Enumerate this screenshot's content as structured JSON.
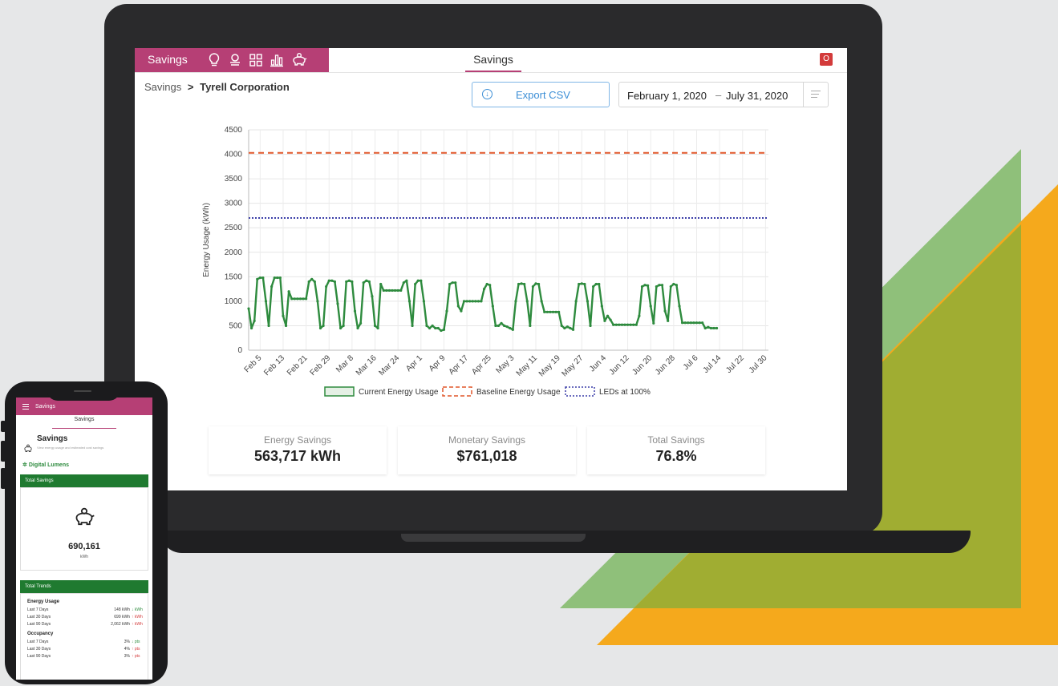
{
  "app": {
    "brand_label": "Savings",
    "center_tab": "Savings",
    "power_label": "O"
  },
  "nav_icons": [
    "lightbulb-icon",
    "occupancy-icon",
    "grid-icon",
    "bar-chart-icon",
    "piggy-bank-icon"
  ],
  "breadcrumb": {
    "root": "Savings",
    "separator": ">",
    "current": "Tyrell Corporation"
  },
  "toolbar": {
    "export_label": "Export CSV"
  },
  "date_range": {
    "start": "February 1, 2020",
    "separator": "–",
    "end": "July 31, 2020"
  },
  "colors": {
    "brand": "#b63f75",
    "current": "#2e8b3e",
    "baseline": "#e0572a",
    "leds": "#3b3fa8",
    "accent_green": "#1f7a30"
  },
  "chart_data": {
    "type": "line",
    "ylabel": "Energy Usage (kWh)",
    "ylim": [
      0,
      4500
    ],
    "yticks": [
      "0",
      "500",
      "1000",
      "1500",
      "2000",
      "2500",
      "3000",
      "3500",
      "4000",
      "4500"
    ],
    "xtick_labels": [
      "Feb 5",
      "Feb 13",
      "Feb 21",
      "Feb 29",
      "Mar 8",
      "Mar 16",
      "Mar 24",
      "Apr 1",
      "Apr 9",
      "Apr 17",
      "Apr 25",
      "May 3",
      "May 11",
      "May 19",
      "May 27",
      "Jun 4",
      "Jun 12",
      "Jun 20",
      "Jun 28",
      "Jul 6",
      "Jul 14",
      "Jul 22",
      "Jul 30"
    ],
    "grid": true,
    "legend_position": "bottom",
    "x_start": "2020-02-01",
    "x_end": "2020-07-31",
    "series": [
      {
        "name": "Current Energy Usage",
        "style": "solid",
        "color": "#2e8b3e",
        "points": [
          [
            "2020-02-01",
            850
          ],
          [
            "2020-02-02",
            450
          ],
          [
            "2020-02-03",
            600
          ],
          [
            "2020-02-04",
            1450
          ],
          [
            "2020-02-05",
            1480
          ],
          [
            "2020-02-06",
            1480
          ],
          [
            "2020-02-07",
            1000
          ],
          [
            "2020-02-08",
            500
          ],
          [
            "2020-02-09",
            1300
          ],
          [
            "2020-02-10",
            1480
          ],
          [
            "2020-02-11",
            1480
          ],
          [
            "2020-02-12",
            1480
          ],
          [
            "2020-02-13",
            700
          ],
          [
            "2020-02-14",
            500
          ],
          [
            "2020-02-15",
            1200
          ],
          [
            "2020-02-16",
            1050
          ],
          [
            "2020-02-17",
            1050
          ],
          [
            "2020-02-18",
            1050
          ],
          [
            "2020-02-19",
            1050
          ],
          [
            "2020-02-20",
            1050
          ],
          [
            "2020-02-21",
            1050
          ],
          [
            "2020-02-22",
            1400
          ],
          [
            "2020-02-23",
            1450
          ],
          [
            "2020-02-24",
            1400
          ],
          [
            "2020-02-25",
            1000
          ],
          [
            "2020-02-26",
            450
          ],
          [
            "2020-02-27",
            500
          ],
          [
            "2020-02-28",
            1300
          ],
          [
            "2020-02-29",
            1420
          ],
          [
            "2020-03-01",
            1420
          ],
          [
            "2020-03-02",
            1400
          ],
          [
            "2020-03-03",
            950
          ],
          [
            "2020-03-04",
            450
          ],
          [
            "2020-03-05",
            500
          ],
          [
            "2020-03-06",
            1400
          ],
          [
            "2020-03-07",
            1420
          ],
          [
            "2020-03-08",
            1400
          ],
          [
            "2020-03-09",
            800
          ],
          [
            "2020-03-10",
            450
          ],
          [
            "2020-03-11",
            550
          ],
          [
            "2020-03-12",
            1380
          ],
          [
            "2020-03-13",
            1420
          ],
          [
            "2020-03-14",
            1400
          ],
          [
            "2020-03-15",
            1100
          ],
          [
            "2020-03-16",
            500
          ],
          [
            "2020-03-17",
            450
          ],
          [
            "2020-03-18",
            1350
          ],
          [
            "2020-03-19",
            1220
          ],
          [
            "2020-03-20",
            1220
          ],
          [
            "2020-03-21",
            1220
          ],
          [
            "2020-03-22",
            1220
          ],
          [
            "2020-03-23",
            1220
          ],
          [
            "2020-03-24",
            1220
          ],
          [
            "2020-03-25",
            1220
          ],
          [
            "2020-03-26",
            1380
          ],
          [
            "2020-03-27",
            1420
          ],
          [
            "2020-03-28",
            1000
          ],
          [
            "2020-03-29",
            500
          ],
          [
            "2020-03-30",
            1350
          ],
          [
            "2020-03-31",
            1420
          ],
          [
            "2020-04-01",
            1420
          ],
          [
            "2020-04-02",
            1000
          ],
          [
            "2020-04-03",
            500
          ],
          [
            "2020-04-04",
            450
          ],
          [
            "2020-04-05",
            500
          ],
          [
            "2020-04-06",
            450
          ],
          [
            "2020-04-07",
            450
          ],
          [
            "2020-04-08",
            400
          ],
          [
            "2020-04-09",
            420
          ],
          [
            "2020-04-10",
            800
          ],
          [
            "2020-04-11",
            1350
          ],
          [
            "2020-04-12",
            1380
          ],
          [
            "2020-04-13",
            1380
          ],
          [
            "2020-04-14",
            900
          ],
          [
            "2020-04-15",
            800
          ],
          [
            "2020-04-16",
            1000
          ],
          [
            "2020-04-17",
            1000
          ],
          [
            "2020-04-18",
            1000
          ],
          [
            "2020-04-19",
            1000
          ],
          [
            "2020-04-20",
            1000
          ],
          [
            "2020-04-21",
            1000
          ],
          [
            "2020-04-22",
            1000
          ],
          [
            "2020-04-23",
            1250
          ],
          [
            "2020-04-24",
            1350
          ],
          [
            "2020-04-25",
            1330
          ],
          [
            "2020-04-26",
            900
          ],
          [
            "2020-04-27",
            500
          ],
          [
            "2020-04-28",
            500
          ],
          [
            "2020-04-29",
            550
          ],
          [
            "2020-04-30",
            500
          ],
          [
            "2020-05-01",
            480
          ],
          [
            "2020-05-02",
            450
          ],
          [
            "2020-05-03",
            420
          ],
          [
            "2020-05-04",
            1000
          ],
          [
            "2020-05-05",
            1350
          ],
          [
            "2020-05-06",
            1360
          ],
          [
            "2020-05-07",
            1350
          ],
          [
            "2020-05-08",
            1000
          ],
          [
            "2020-05-09",
            500
          ],
          [
            "2020-05-10",
            1300
          ],
          [
            "2020-05-11",
            1360
          ],
          [
            "2020-05-12",
            1350
          ],
          [
            "2020-05-13",
            1000
          ],
          [
            "2020-05-14",
            780
          ],
          [
            "2020-05-15",
            780
          ],
          [
            "2020-05-16",
            780
          ],
          [
            "2020-05-17",
            780
          ],
          [
            "2020-05-18",
            780
          ],
          [
            "2020-05-19",
            780
          ],
          [
            "2020-05-20",
            500
          ],
          [
            "2020-05-21",
            450
          ],
          [
            "2020-05-22",
            480
          ],
          [
            "2020-05-23",
            450
          ],
          [
            "2020-05-24",
            420
          ],
          [
            "2020-05-25",
            1000
          ],
          [
            "2020-05-26",
            1350
          ],
          [
            "2020-05-27",
            1360
          ],
          [
            "2020-05-28",
            1350
          ],
          [
            "2020-05-29",
            1000
          ],
          [
            "2020-05-30",
            500
          ],
          [
            "2020-05-31",
            1300
          ],
          [
            "2020-06-01",
            1350
          ],
          [
            "2020-06-02",
            1350
          ],
          [
            "2020-06-03",
            900
          ],
          [
            "2020-06-04",
            600
          ],
          [
            "2020-06-05",
            700
          ],
          [
            "2020-06-06",
            620
          ],
          [
            "2020-06-07",
            520
          ],
          [
            "2020-06-08",
            520
          ],
          [
            "2020-06-09",
            520
          ],
          [
            "2020-06-10",
            520
          ],
          [
            "2020-06-11",
            520
          ],
          [
            "2020-06-12",
            520
          ],
          [
            "2020-06-13",
            520
          ],
          [
            "2020-06-14",
            520
          ],
          [
            "2020-06-15",
            520
          ],
          [
            "2020-06-16",
            700
          ],
          [
            "2020-06-17",
            1300
          ],
          [
            "2020-06-18",
            1330
          ],
          [
            "2020-06-19",
            1320
          ],
          [
            "2020-06-20",
            900
          ],
          [
            "2020-06-21",
            550
          ],
          [
            "2020-06-22",
            1300
          ],
          [
            "2020-06-23",
            1330
          ],
          [
            "2020-06-24",
            1330
          ],
          [
            "2020-06-25",
            800
          ],
          [
            "2020-06-26",
            600
          ],
          [
            "2020-06-27",
            1300
          ],
          [
            "2020-06-28",
            1350
          ],
          [
            "2020-06-29",
            1330
          ],
          [
            "2020-06-30",
            900
          ],
          [
            "2020-07-01",
            560
          ],
          [
            "2020-07-02",
            560
          ],
          [
            "2020-07-03",
            560
          ],
          [
            "2020-07-04",
            560
          ],
          [
            "2020-07-05",
            560
          ],
          [
            "2020-07-06",
            560
          ],
          [
            "2020-07-07",
            560
          ],
          [
            "2020-07-08",
            560
          ],
          [
            "2020-07-09",
            450
          ],
          [
            "2020-07-10",
            470
          ],
          [
            "2020-07-11",
            450
          ],
          [
            "2020-07-12",
            450
          ],
          [
            "2020-07-13",
            450
          ]
        ]
      },
      {
        "name": "Baseline Energy Usage",
        "style": "dashed",
        "color": "#e0572a",
        "value": 4030
      },
      {
        "name": "LEDs at 100%",
        "style": "dotted",
        "color": "#3b3fa8",
        "value": 2700
      }
    ]
  },
  "summary_cards": [
    {
      "title": "Energy Savings",
      "value": "563,717 kWh"
    },
    {
      "title": "Monetary Savings",
      "value": "$761,018"
    },
    {
      "title": "Total Savings",
      "value": "76.8%"
    }
  ],
  "phone": {
    "header_title": "Savings",
    "tab_label": "Savings",
    "section_title": "Savings",
    "section_sub": "View energy usage and estimated cost savings",
    "brand_name": "Digital Lumens",
    "total_savings_label": "Total Savings",
    "total_value": "690,161",
    "total_unit": "kWh",
    "trends_label": "Total Trends",
    "groups": [
      {
        "title": "Energy Usage",
        "rows": [
          {
            "label": "Last 7 Days",
            "value": "148 kWh",
            "change": "↓ kWh",
            "dir": "dn"
          },
          {
            "label": "Last 30 Days",
            "value": "699 kWh",
            "change": "↑ kWh",
            "dir": "up"
          },
          {
            "label": "Last 90 Days",
            "value": "2,062 kWh",
            "change": "↑ kWh",
            "dir": "up"
          }
        ]
      },
      {
        "title": "Occupancy",
        "rows": [
          {
            "label": "Last 7 Days",
            "value": "3%",
            "change": "↓ pts",
            "dir": "dn"
          },
          {
            "label": "Last 30 Days",
            "value": "4%",
            "change": "↑ pts",
            "dir": "up"
          },
          {
            "label": "Last 90 Days",
            "value": "3%",
            "change": "↑ pts",
            "dir": "up"
          }
        ]
      }
    ]
  }
}
